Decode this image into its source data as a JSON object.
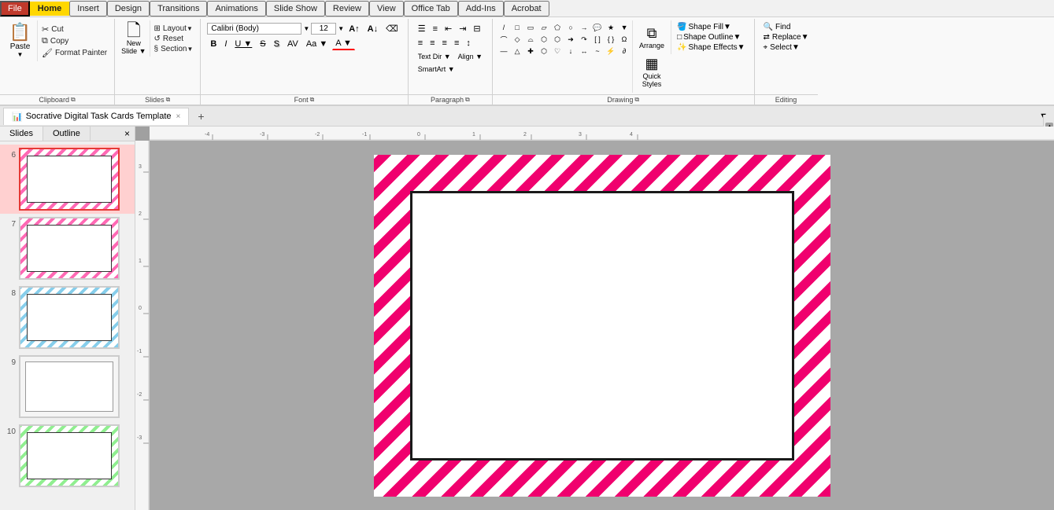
{
  "app": {
    "title": "Socrative Digital Task Cards Template - PowerPoint",
    "file_tab": "File",
    "menu_items": [
      "File",
      "Home",
      "Insert",
      "Design",
      "Transitions",
      "Animations",
      "Slide Show",
      "Review",
      "View",
      "Office Tab",
      "Add-Ins",
      "Acrobat"
    ]
  },
  "ribbon": {
    "clipboard": {
      "label": "Clipboard",
      "paste": "Paste",
      "cut": "Cut",
      "copy": "Copy",
      "format_painter": "Format Painter"
    },
    "slides": {
      "label": "Slides",
      "new_slide": "New Slide",
      "layout": "Layout",
      "reset": "Reset",
      "section": "Section"
    },
    "font": {
      "label": "Font",
      "font_name": "Calibri (Body)",
      "font_size": "12",
      "bold": "B",
      "italic": "I",
      "underline": "U",
      "strikethrough": "S",
      "shadow": "S",
      "char_spacing": "AV",
      "change_case": "Aa",
      "font_color": "A"
    },
    "paragraph": {
      "label": "Paragraph",
      "text_direction": "Text Direction",
      "align_text": "Align Text",
      "convert_smartart": "Convert to SmartArt"
    },
    "drawing": {
      "label": "Drawing",
      "arrange": "Arrange",
      "quick_styles": "Quick Styles",
      "shape_fill": "Shape Fill",
      "shape_outline": "Shape Outline",
      "shape_effects": "Shape Effects"
    },
    "editing": {
      "label": "Editing",
      "find": "Find",
      "replace": "Replace",
      "select": "Select"
    }
  },
  "document_tab": {
    "title": "Socrative Digital Task Cards Template",
    "close": "×"
  },
  "sidebar": {
    "tabs": [
      "Slides",
      "Outline"
    ],
    "close": "×",
    "slides": [
      {
        "num": "6",
        "type": "pink",
        "selected": true
      },
      {
        "num": "7",
        "type": "pink",
        "selected": false
      },
      {
        "num": "8",
        "type": "blue",
        "selected": false
      },
      {
        "num": "9",
        "type": "none",
        "selected": false
      },
      {
        "num": "10",
        "type": "green",
        "selected": false
      }
    ]
  },
  "ruler": {
    "h_ticks": [
      "-4",
      "-3",
      "-2",
      "-1",
      "0",
      "1",
      "2",
      "3",
      "4"
    ],
    "v_ticks": [
      "3",
      "2",
      "1",
      "0",
      "-1",
      "-2",
      "-3"
    ]
  }
}
